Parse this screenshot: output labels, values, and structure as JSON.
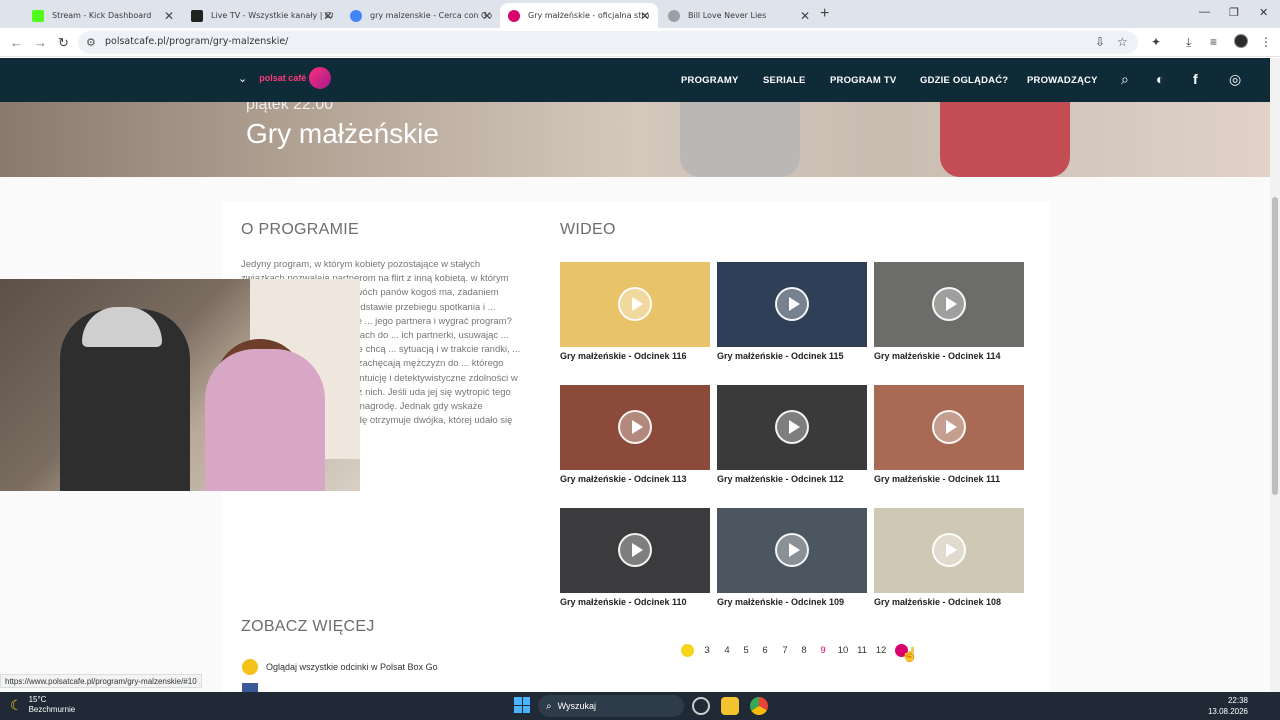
{
  "browser": {
    "tabs": [
      {
        "title": "Stream - Kick Dashboard",
        "color": "#53fc18"
      },
      {
        "title": "Live TV - Wszystkie kanały | CANAL+",
        "color": "#222222"
      },
      {
        "title": "gry malzenskie - Cerca con Google",
        "color": "#4285f4"
      },
      {
        "title": "Gry małżeńskie - oficjalna strona",
        "color": "#d7006e"
      },
      {
        "title": "Bill Love Never Lies",
        "color": "#9aa0a6"
      }
    ],
    "url": "polsatcafe.pl/program/gry-malzenskie/"
  },
  "site": {
    "logo_text": "polsat café",
    "nav": [
      "PROGRAMY",
      "SERIALE",
      "PROGRAM TV",
      "GDZIE OGLĄDAĆ?",
      "PROWADZĄCY"
    ],
    "accent": "#d7006e"
  },
  "hero": {
    "time": "piątek 22:00",
    "title": "Gry małżeńskie"
  },
  "about": {
    "heading": "O PROGRAMIE",
    "text": "Jedyny program, w którym kobiety pozostające w stałych związkach pozwalają partnerom na flirt z inną kobietą. w którym singielka spotyka się z ... Dwóch panów kogoś ma, zadaniem bohaterki programu ... na podstawie przebiegu spotkania i ... zdolne są uczestniczki, które ... jego partnera i wygrać program? ... ponieważ w przygotowaniach do ... ich partnerki, usuwając ... obecności w mieszkaniu. Nie chcą ... sytuacją i w trakcie randki, ... w pokoju obok, udzielają ... zachęcają mężczyzn do ... którego singielka będzie musiała ... intuicję i detektywistyczne zdolności w trakcie spotkania z każdym z nich. Jeśli uda jej się wytropić tego bez pary, to oboje zgarniają nagrodę. Jednak gdy wskaże zajętego mężczyznę, nagrodę otrzymuje dwójka, której udało się ją zwieść."
  },
  "more": {
    "heading": "ZOBACZ WIĘCEJ",
    "boxgo": "Oglądaj wszystkie odcinki w Polsat Box Go"
  },
  "video": {
    "heading": "WIDEO",
    "items": [
      {
        "title": "Gry małżeńskie - Odcinek 116",
        "bg": "#e9c36a"
      },
      {
        "title": "Gry małżeńskie - Odcinek 115",
        "bg": "#2f3f57"
      },
      {
        "title": "Gry małżeńskie - Odcinek 114",
        "bg": "#6c6d6a"
      },
      {
        "title": "Gry małżeńskie - Odcinek 113",
        "bg": "#8b4a3a"
      },
      {
        "title": "Gry małżeńskie - Odcinek 112",
        "bg": "#3a3a3a"
      },
      {
        "title": "Gry małżeńskie - Odcinek 111",
        "bg": "#a86a55"
      },
      {
        "title": "Gry małżeńskie - Odcinek 110",
        "bg": "#3b3b3d"
      },
      {
        "title": "Gry małżeńskie - Odcinek 109",
        "bg": "#4b5660"
      },
      {
        "title": "Gry małżeńskie - Odcinek 108",
        "bg": "#cfc8b4"
      }
    ]
  },
  "pagination": {
    "pages": [
      "3",
      "4",
      "5",
      "6",
      "7",
      "8",
      "9",
      "10",
      "11",
      "12"
    ],
    "current": "9"
  },
  "status_url": "https://www.polsatcafe.pl/program/gry-malzenskie/#10",
  "taskbar": {
    "temp": "15°C",
    "weather": "Bezchmurnie",
    "search": "Wyszukaj",
    "time": "22:38",
    "date": "13.08.2026"
  }
}
